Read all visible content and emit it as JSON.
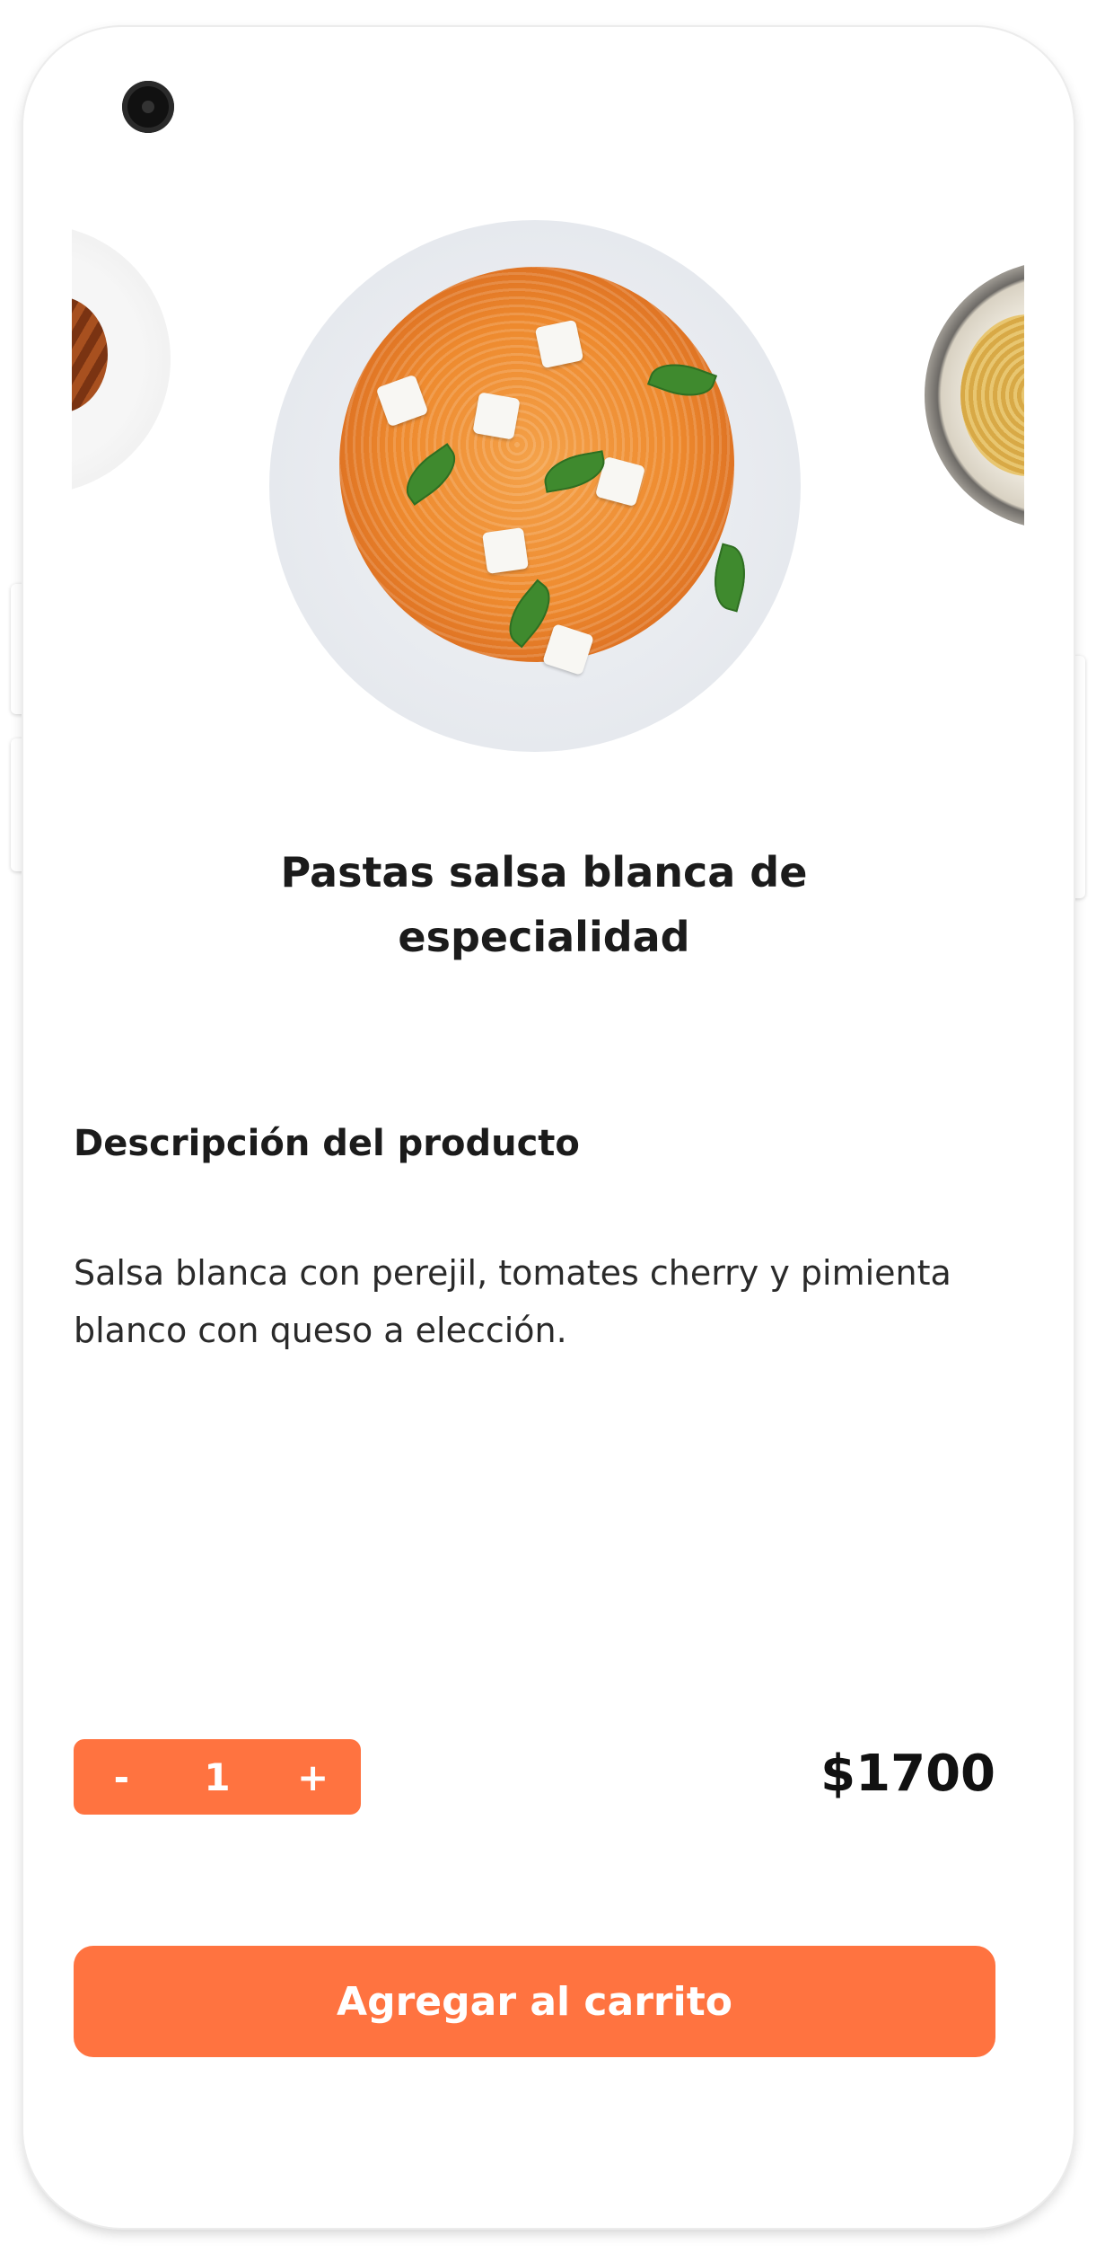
{
  "product": {
    "title": "Pastas salsa blanca de especialidad",
    "description_heading": "Descripción del producto",
    "description": "Salsa blanca con perejil, tomates cherry y pimienta blanco con queso a elección."
  },
  "quantity": {
    "decrement_label": "-",
    "value": "1",
    "increment_label": "+"
  },
  "price": "$1700",
  "add_to_cart_label": "Agregar al carrito",
  "colors": {
    "accent": "#ff7340",
    "text": "#1b1b1b"
  },
  "icons": {
    "camera": "front-camera-icon"
  }
}
